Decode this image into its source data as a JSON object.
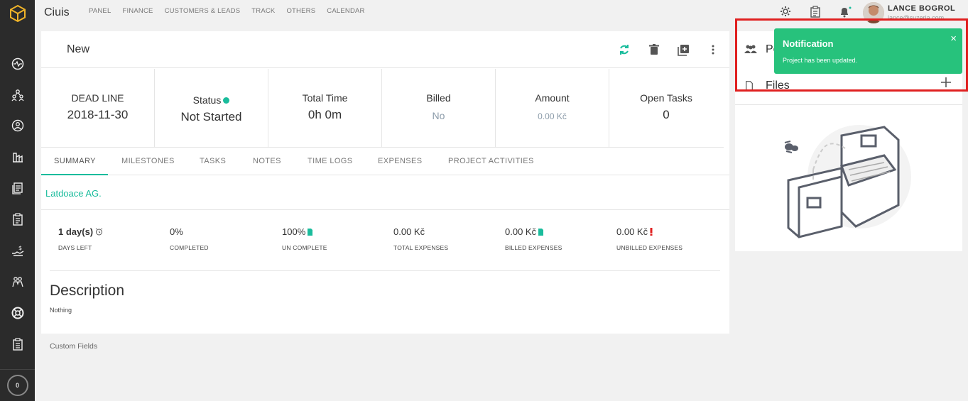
{
  "app": {
    "name": "Ciuis"
  },
  "topnav": [
    "PANEL",
    "FINANCE",
    "CUSTOMERS & LEADS",
    "TRACK",
    "OTHERS",
    "CALENDAR"
  ],
  "user": {
    "name": "LANCE BOGROL",
    "email": "lance@suzeria.com"
  },
  "sidebar": {
    "icons": [
      "dashboard-icon",
      "leads-icon",
      "customers-icon",
      "projects-icon",
      "invoices-icon",
      "documents-icon",
      "expenses-icon",
      "staff-icon",
      "support-icon",
      "tasks-icon"
    ],
    "counter": "0"
  },
  "project": {
    "title": "New",
    "stats": {
      "deadline_label": "DEAD LINE",
      "deadline_value": "2018-11-30",
      "status_label": "Status",
      "status_value": "Not Started",
      "total_time_label": "Total Time",
      "total_time_value": "0h 0m",
      "billed_label": "Billed",
      "billed_value": "No",
      "amount_label": "Amount",
      "amount_value": "0.00 Kč",
      "open_tasks_label": "Open Tasks",
      "open_tasks_value": "0"
    },
    "tabs": [
      "SUMMARY",
      "MILESTONES",
      "TASKS",
      "NOTES",
      "TIME LOGS",
      "EXPENSES",
      "PROJECT ACTIVITIES"
    ],
    "client": "Latdoace AG.",
    "metrics": [
      {
        "value": "1 day(s)",
        "label": "DAYS LEFT"
      },
      {
        "value": "0%",
        "label": "COMPLETED"
      },
      {
        "value": "100%",
        "label": "UN COMPLETE"
      },
      {
        "value": "0.00 Kč",
        "label": "TOTAL EXPENSES"
      },
      {
        "value": "0.00 Kč",
        "label": "BILLED EXPENSES"
      },
      {
        "value": "0.00 Kč",
        "label": "UNBILLED EXPENSES"
      }
    ],
    "description_title": "Description",
    "description_body": "Nothing",
    "custom_fields": "Custom Fields"
  },
  "right_panel": {
    "people_label": "Pe",
    "files_label": "Files"
  },
  "notification": {
    "title": "Notification",
    "message": "Project has been updated.",
    "close": "×"
  },
  "colors": {
    "accent": "#1abc9c",
    "notification": "#27c27c",
    "sidebar": "#2b2b2b",
    "highlight": "#e02020"
  }
}
